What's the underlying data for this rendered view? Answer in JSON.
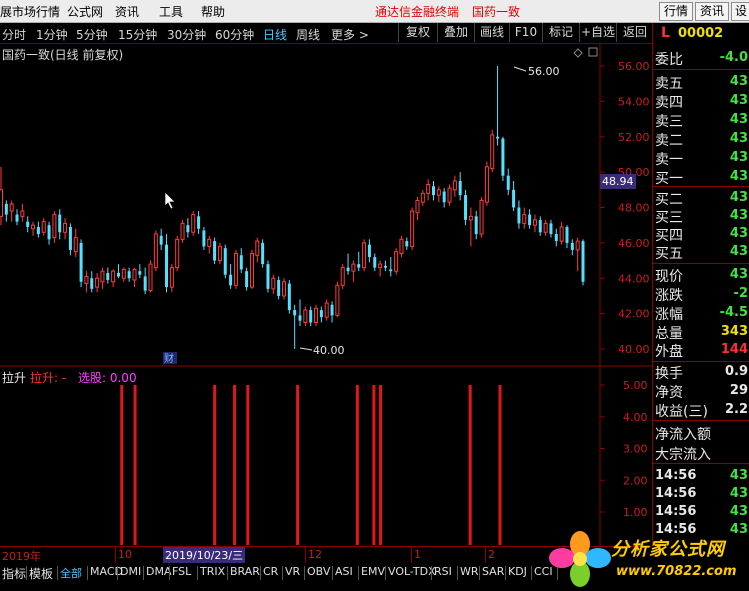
{
  "menubar": {
    "items": [
      "展市场行情",
      "公式网",
      "资讯",
      "工具",
      "帮助"
    ],
    "brand": "通达信金融终端",
    "stock_name": "国药一致",
    "buttons": [
      "行情",
      "资讯",
      "设"
    ]
  },
  "period_bar": {
    "periods": [
      "分时",
      "1分钟",
      "5分钟",
      "15分钟",
      "30分钟",
      "60分钟",
      "日线",
      "周线",
      "更多 >"
    ],
    "active": "日线",
    "tools": [
      "复权",
      "叠加",
      "画线",
      "F10",
      "标记",
      "+自选",
      "返回"
    ]
  },
  "chart": {
    "title": "国药一致(日线 前复权)",
    "high_label": "56.00",
    "low_label": "40.00",
    "current_price_tag": "48.94",
    "cai_marker": "财",
    "y_ticks": [
      "56.00",
      "54.00",
      "52.00",
      "50.00",
      "48.00",
      "46.00",
      "44.00",
      "42.00",
      "40.00"
    ]
  },
  "indicator": {
    "name": "拉升",
    "label": "拉升: -",
    "select_label": "选股: 0.00",
    "y_ticks": [
      "5.00",
      "4.00",
      "3.00",
      "2.00",
      "1.00"
    ]
  },
  "date_axis": {
    "labels": [
      "2019年",
      "10",
      "2019/10/23/三",
      "12",
      "1",
      "2"
    ]
  },
  "quote_panel": {
    "code": "00002",
    "code_prefix": "L",
    "rows": [
      {
        "label": "委比",
        "value": "-4.0",
        "color": "#44e044"
      },
      {
        "label": "卖五",
        "value": "43",
        "color": "#44e044"
      },
      {
        "label": "卖四",
        "value": "43",
        "color": "#44e044"
      },
      {
        "label": "卖三",
        "value": "43",
        "color": "#44e044"
      },
      {
        "label": "卖二",
        "value": "43",
        "color": "#44e044"
      },
      {
        "label": "卖一",
        "value": "43",
        "color": "#44e044"
      },
      {
        "label": "买一",
        "value": "43",
        "color": "#44e044"
      },
      {
        "label": "买二",
        "value": "43",
        "color": "#44e044"
      },
      {
        "label": "买三",
        "value": "43",
        "color": "#44e044"
      },
      {
        "label": "买四",
        "value": "43",
        "color": "#44e044"
      },
      {
        "label": "买五",
        "value": "43",
        "color": "#44e044"
      },
      {
        "label": "现价",
        "value": "43",
        "color": "#44e044"
      },
      {
        "label": "涨跌",
        "value": "-2",
        "color": "#44e044"
      },
      {
        "label": "涨幅",
        "value": "-4.5",
        "color": "#44e044"
      },
      {
        "label": "总量",
        "value": "343",
        "color": "#f0e000"
      },
      {
        "label": "外盘",
        "value": "144",
        "color": "#ff3030"
      },
      {
        "label": "换手",
        "value": "0.9",
        "color": "#e8e8e8"
      },
      {
        "label": "净资",
        "value": "29",
        "color": "#e8e8e8"
      },
      {
        "label": "收益(三)",
        "value": "2.2",
        "color": "#e8e8e8"
      },
      {
        "label": "净流入额",
        "value": "",
        "color": "#e8e8e8"
      },
      {
        "label": "大宗流入",
        "value": "",
        "color": "#e8e8e8"
      }
    ],
    "ticks": [
      {
        "time": "14:56",
        "price": "43"
      },
      {
        "time": "14:56",
        "price": "43"
      },
      {
        "time": "14:56",
        "price": "43"
      },
      {
        "time": "14:56",
        "price": "43"
      }
    ]
  },
  "bottom_tabs": {
    "items": [
      "指标",
      "模板",
      "全部",
      "MACD",
      "DMI",
      "DMA",
      "FSL",
      "TRIX",
      "BRAR",
      "CR",
      "VR",
      "OBV",
      "ASI",
      "EMV",
      "VOL-TDX",
      "RSI",
      "WR",
      "SAR",
      "KDJ",
      "CCI"
    ],
    "selected": "全部"
  },
  "watermark": {
    "title": "分析家公式网",
    "url": "www.70822.com"
  },
  "colors": {
    "up": "#ff3c3c",
    "down": "#54e0ff",
    "signal": "#e01818",
    "grid_axis": "#8a0000"
  },
  "chart_data": {
    "type": "candlestick",
    "ylim": [
      39.4,
      56.6
    ],
    "candles": [
      [
        47.5,
        50.3,
        47.0,
        49.0
      ],
      [
        48.2,
        48.4,
        47.2,
        47.6
      ],
      [
        47.8,
        48.4,
        47.2,
        48.2
      ],
      [
        47.6,
        47.9,
        47.0,
        47.2
      ],
      [
        47.5,
        48.2,
        47.2,
        47.8
      ],
      [
        47.2,
        47.5,
        46.6,
        46.9
      ],
      [
        46.8,
        47.2,
        46.4,
        47.0
      ],
      [
        46.9,
        47.2,
        46.3,
        46.5
      ],
      [
        46.6,
        47.4,
        46.4,
        47.2
      ],
      [
        47.0,
        47.2,
        45.9,
        46.2
      ],
      [
        46.3,
        47.8,
        46.0,
        47.6
      ],
      [
        47.6,
        47.9,
        46.2,
        46.6
      ],
      [
        46.6,
        47.4,
        46.2,
        47.1
      ],
      [
        46.9,
        47.1,
        45.3,
        45.6
      ],
      [
        45.5,
        46.8,
        45.2,
        46.3
      ],
      [
        46.0,
        46.2,
        43.5,
        43.8
      ],
      [
        43.7,
        44.4,
        43.2,
        44.1
      ],
      [
        44.0,
        44.4,
        43.2,
        43.4
      ],
      [
        43.5,
        44.3,
        43.2,
        44.0
      ],
      [
        43.8,
        44.6,
        43.4,
        44.4
      ],
      [
        44.3,
        44.6,
        43.7,
        43.9
      ],
      [
        43.8,
        44.5,
        43.5,
        44.4
      ],
      [
        44.3,
        44.8,
        44.0,
        44.1
      ],
      [
        44.0,
        44.6,
        43.8,
        44.5
      ],
      [
        44.4,
        44.6,
        43.8,
        44.0
      ],
      [
        43.9,
        44.6,
        43.5,
        44.5
      ],
      [
        44.4,
        44.8,
        44.0,
        44.2
      ],
      [
        44.1,
        44.6,
        43.1,
        43.3
      ],
      [
        43.3,
        45.0,
        43.2,
        44.8
      ],
      [
        44.6,
        46.7,
        44.4,
        46.5
      ],
      [
        46.4,
        46.8,
        45.6,
        45.9
      ],
      [
        45.9,
        46.5,
        43.2,
        43.5
      ],
      [
        43.5,
        44.8,
        43.2,
        44.6
      ],
      [
        44.6,
        46.4,
        44.4,
        46.2
      ],
      [
        46.2,
        47.3,
        46.0,
        47.1
      ],
      [
        47.0,
        47.4,
        46.3,
        46.6
      ],
      [
        46.6,
        47.8,
        46.4,
        47.6
      ],
      [
        47.5,
        47.8,
        46.5,
        46.8
      ],
      [
        46.7,
        46.9,
        45.6,
        45.8
      ],
      [
        45.8,
        46.4,
        45.4,
        46.2
      ],
      [
        46.1,
        46.3,
        44.8,
        45.0
      ],
      [
        45.0,
        46.0,
        44.8,
        45.8
      ],
      [
        45.7,
        45.9,
        44.0,
        44.2
      ],
      [
        44.2,
        44.8,
        43.4,
        43.6
      ],
      [
        43.6,
        45.6,
        43.4,
        45.4
      ],
      [
        45.3,
        45.7,
        44.3,
        44.5
      ],
      [
        44.4,
        44.6,
        43.3,
        43.5
      ],
      [
        43.5,
        45.6,
        43.4,
        45.4
      ],
      [
        45.3,
        46.3,
        44.9,
        46.1
      ],
      [
        46.0,
        46.2,
        44.6,
        44.8
      ],
      [
        44.8,
        45.0,
        43.2,
        43.4
      ],
      [
        43.4,
        44.2,
        43.1,
        44.0
      ],
      [
        43.9,
        44.1,
        42.8,
        43.0
      ],
      [
        43.0,
        44.0,
        42.8,
        43.8
      ],
      [
        43.7,
        43.9,
        42.0,
        42.2
      ],
      [
        42.2,
        42.5,
        40.0,
        41.9
      ],
      [
        41.9,
        42.8,
        41.3,
        41.6
      ],
      [
        41.5,
        42.4,
        41.3,
        42.2
      ],
      [
        42.2,
        42.4,
        41.3,
        41.5
      ],
      [
        41.5,
        42.5,
        41.3,
        42.3
      ],
      [
        42.2,
        42.4,
        41.5,
        41.8
      ],
      [
        41.8,
        42.8,
        41.6,
        42.6
      ],
      [
        42.5,
        42.7,
        41.5,
        41.9
      ],
      [
        41.9,
        43.8,
        41.8,
        43.6
      ],
      [
        43.6,
        44.8,
        43.4,
        44.6
      ],
      [
        44.6,
        45.4,
        44.2,
        44.4
      ],
      [
        44.4,
        45.0,
        43.8,
        44.8
      ],
      [
        44.8,
        45.5,
        44.4,
        44.6
      ],
      [
        44.6,
        46.2,
        44.4,
        46.0
      ],
      [
        45.9,
        46.2,
        44.9,
        45.2
      ],
      [
        45.2,
        45.4,
        44.4,
        44.6
      ],
      [
        44.6,
        45.0,
        44.1,
        44.8
      ],
      [
        44.7,
        45.0,
        44.4,
        44.6
      ],
      [
        44.5,
        45.2,
        44.1,
        44.4
      ],
      [
        44.4,
        45.7,
        44.2,
        45.5
      ],
      [
        45.4,
        46.4,
        45.2,
        46.2
      ],
      [
        46.1,
        46.3,
        45.6,
        45.8
      ],
      [
        45.8,
        48.0,
        45.6,
        47.8
      ],
      [
        47.7,
        48.6,
        47.3,
        48.4
      ],
      [
        48.3,
        49.0,
        48.1,
        48.8
      ],
      [
        48.8,
        49.6,
        48.4,
        49.3
      ],
      [
        49.2,
        49.5,
        48.4,
        48.7
      ],
      [
        48.7,
        49.2,
        48.3,
        49.0
      ],
      [
        48.9,
        49.1,
        48.0,
        48.3
      ],
      [
        48.3,
        49.3,
        48.1,
        49.1
      ],
      [
        49.0,
        49.8,
        48.6,
        49.5
      ],
      [
        49.5,
        50.0,
        48.4,
        48.7
      ],
      [
        48.7,
        49.0,
        47.0,
        47.3
      ],
      [
        47.3,
        48.0,
        45.8,
        47.5
      ],
      [
        47.5,
        47.8,
        46.2,
        46.5
      ],
      [
        46.5,
        48.6,
        46.3,
        48.4
      ],
      [
        48.3,
        50.6,
        48.1,
        50.3
      ],
      [
        50.2,
        52.4,
        50.0,
        52.1
      ],
      [
        52.0,
        56.0,
        51.5,
        51.9
      ],
      [
        51.9,
        52.0,
        49.5,
        49.8
      ],
      [
        49.8,
        50.2,
        48.7,
        49.0
      ],
      [
        49.0,
        49.5,
        47.8,
        48.0
      ],
      [
        48.0,
        48.4,
        46.8,
        47.1
      ],
      [
        47.1,
        48.0,
        46.8,
        47.6
      ],
      [
        47.6,
        47.9,
        46.8,
        47.0
      ],
      [
        47.0,
        47.6,
        46.6,
        47.3
      ],
      [
        47.3,
        47.5,
        46.4,
        46.6
      ],
      [
        46.6,
        47.3,
        46.4,
        47.1
      ],
      [
        47.1,
        47.3,
        46.3,
        46.5
      ],
      [
        46.5,
        46.8,
        45.8,
        46.1
      ],
      [
        46.1,
        47.2,
        45.9,
        46.9
      ],
      [
        46.9,
        47.0,
        45.7,
        46.0
      ],
      [
        46.0,
        46.2,
        45.3,
        45.6
      ],
      [
        45.6,
        46.3,
        44.4,
        46.1
      ],
      [
        46.1,
        46.2,
        43.6,
        43.8
      ]
    ],
    "signals": [
      {
        "i": 15,
        "v": 5.0
      },
      {
        "i": 19,
        "v": 5.0
      },
      {
        "i": 43,
        "v": 5.0
      },
      {
        "i": 49,
        "v": 5.0
      },
      {
        "i": 53,
        "v": 5.0
      },
      {
        "i": 68,
        "v": 5.0
      },
      {
        "i": 86,
        "v": 5.0
      },
      {
        "i": 91,
        "v": 5.0
      },
      {
        "i": 93,
        "v": 5.0
      },
      {
        "i": 120,
        "v": 5.0
      },
      {
        "i": 129,
        "v": 5.0
      }
    ],
    "signal_total": 160,
    "signal_ylim": [
      0,
      5.3
    ]
  }
}
